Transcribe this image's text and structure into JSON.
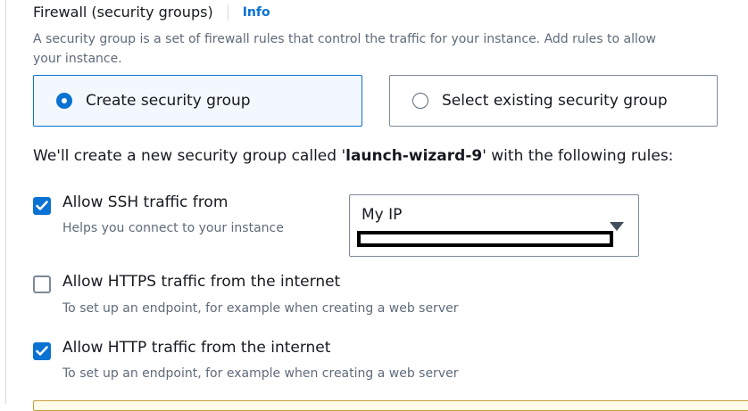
{
  "firewall": {
    "title": "Firewall (security groups)",
    "info_link": "Info",
    "description_line1": "A security group is a set of firewall rules that control the traffic for your instance. Add rules to allow",
    "description_line2": "your instance."
  },
  "security_group_options": [
    {
      "label": "Create security group",
      "selected": true
    },
    {
      "label": "Select existing security group",
      "selected": false
    }
  ],
  "notice": {
    "prefix": "We'll create a new security group called '",
    "group_name": "launch-wizard-9",
    "suffix": "' with the following rules:"
  },
  "rules": [
    {
      "label": "Allow SSH traffic from",
      "help": "Helps you connect to your instance",
      "checked": true
    },
    {
      "label": "Allow HTTPS traffic from the internet",
      "help": "To set up an endpoint, for example when creating a web server",
      "checked": false
    },
    {
      "label": "Allow HTTP traffic from the internet",
      "help": "To set up an endpoint, for example when creating a web server",
      "checked": true
    }
  ],
  "ssh_source_select": {
    "value": "My IP"
  },
  "colors": {
    "accent": "#0972d3",
    "text": "#16191f",
    "muted": "#5f6b7a",
    "border": "#7d8998"
  }
}
